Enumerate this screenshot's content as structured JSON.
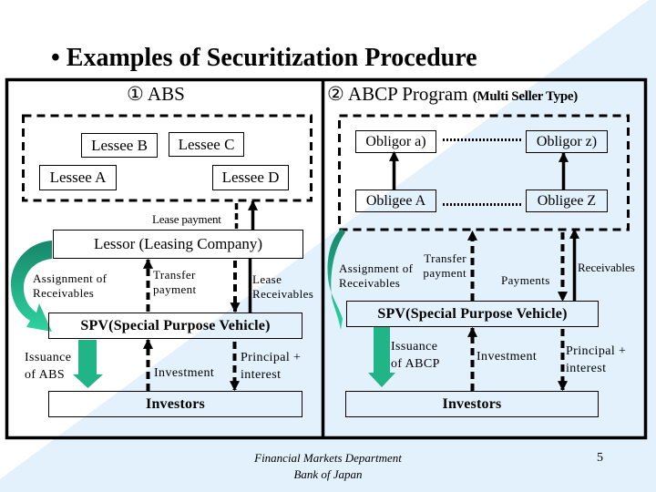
{
  "title": "• Examples of Securitization Procedure",
  "colors": {
    "background_tint": "#e2f1fc",
    "arrow_green_dark": "#16866a",
    "arrow_green_light": "#2fd3a0",
    "arrow_green": "#21b487",
    "line": "#000000"
  },
  "abs": {
    "header": "① ABS",
    "lessees": {
      "b": "Lessee B",
      "c": "Lessee C",
      "a": "Lessee A",
      "d": "Lessee D"
    },
    "lease_payment_label": "Lease payment",
    "lessor": "Lessor (Leasing Company)",
    "assignment_label": [
      "Assignment of",
      "Receivables"
    ],
    "transfer_payment_label": [
      "Transfer",
      "payment"
    ],
    "lease_receivables_label": [
      "Lease",
      "Receivables"
    ],
    "spv": "SPV(Special Purpose Vehicle)",
    "issuance_label": [
      "Issuance",
      "of ABS"
    ],
    "investment_label": "Investment",
    "principal_label": [
      "Principal +",
      "interest"
    ],
    "investors": "Investors"
  },
  "abcp": {
    "header": "② ABCP Program ",
    "header_note": "(Multi Seller Type)",
    "obligors": {
      "a": "Obligor a)",
      "z": "Obligor z)"
    },
    "obligees": {
      "a": "Obligee A",
      "z": "Obligee Z"
    },
    "assignment_label": [
      "Assignment of",
      "Receivables"
    ],
    "transfer_payment_label": [
      "Transfer",
      "payment"
    ],
    "payments_label": "Payments",
    "receivables_label": "Receivables",
    "spv": "SPV(Special Purpose Vehicle)",
    "issuance_label": [
      "Issuance",
      "of ABCP"
    ],
    "investment_label": "Investment",
    "principal_label": [
      "Principal +",
      "interest"
    ],
    "investors": "Investors"
  },
  "footer": {
    "department": "Financial Markets Department",
    "organization": "Bank of Japan",
    "page_number": "5"
  }
}
